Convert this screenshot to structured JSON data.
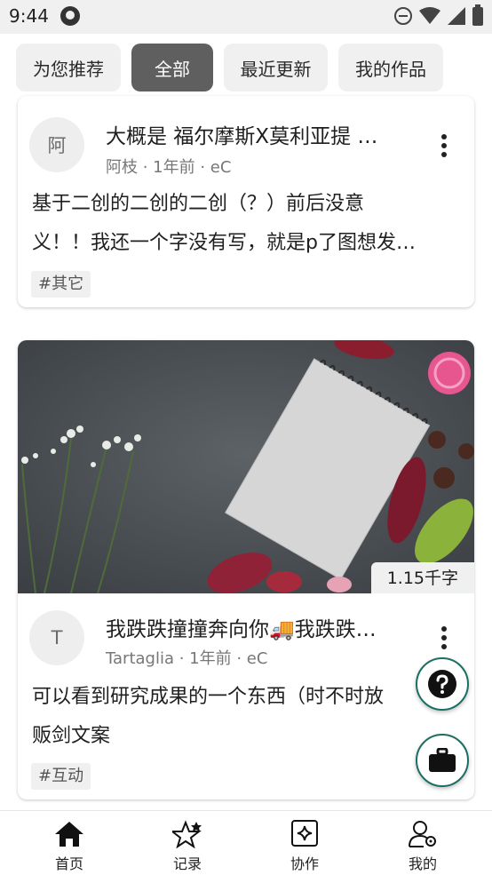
{
  "status_bar": {
    "time": "9:44"
  },
  "filters": [
    {
      "label": "为您推荐",
      "active": false
    },
    {
      "label": "全部",
      "active": true
    },
    {
      "label": "最近更新",
      "active": false
    },
    {
      "label": "我的作品",
      "active": false
    }
  ],
  "posts": [
    {
      "avatar_text": "阿",
      "title": "大概是 福尔摩斯X莫利亚提 …",
      "meta": "阿枝 · 1年前 · eC",
      "body_lines": [
        "基于二创的二创的二创（？）前后没意",
        "义！！我还一个字没有写，就是p了图想发…"
      ],
      "tag": "#其它"
    },
    {
      "avatar_text": "T",
      "word_count": "1.15千字",
      "title": "我跌跌撞撞奔向你🚚我跌跌…",
      "meta": "Tartaglia · 1年前 · eC",
      "body_lines": [
        "可以看到研究成果的一个东西（时不时放",
        "贩剑文案"
      ],
      "tag": "#互动"
    }
  ],
  "bottom_nav": [
    {
      "label": "首页",
      "icon": "home-icon"
    },
    {
      "label": "记录",
      "icon": "stars-icon"
    },
    {
      "label": "协作",
      "icon": "sparkle-badge-icon"
    },
    {
      "label": "我的",
      "icon": "user-settings-icon"
    }
  ],
  "colors": {
    "fab_border": "#1b6e63",
    "chip_active": "#5f5f5f",
    "chip_inactive": "#f0f0f0"
  }
}
